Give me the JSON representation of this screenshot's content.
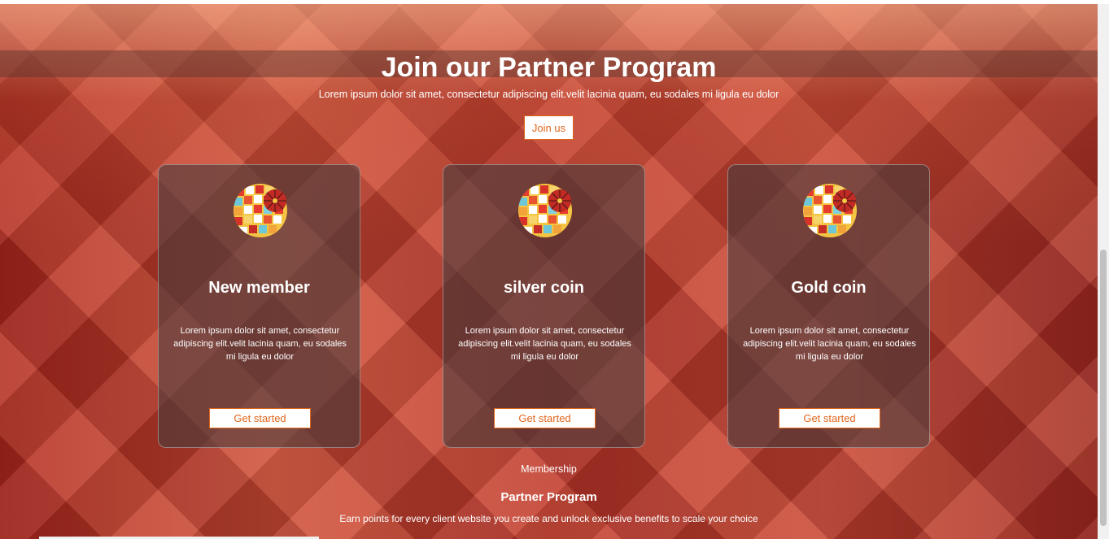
{
  "hero": {
    "title": "Join our Partner Program",
    "subtitle": "Lorem ipsum dolor sit amet, consectetur adipiscing elit.velit lacinia quam, eu sodales mi ligula eu dolor",
    "join_label": "Join us"
  },
  "cards": [
    {
      "title": "New member",
      "description": "Lorem ipsum dolor sit amet, consectetur adipiscing elit.velit lacinia quam, eu sodales mi ligula eu dolor",
      "button_label": "Get started"
    },
    {
      "title": "silver coin",
      "description": "Lorem ipsum dolor sit amet, consectetur adipiscing elit.velit lacinia quam, eu sodales mi ligula eu dolor",
      "button_label": "Get started"
    },
    {
      "title": "Gold coin",
      "description": "Lorem ipsum dolor sit amet, consectetur adipiscing elit.velit lacinia quam, eu sodales mi ligula eu dolor",
      "button_label": "Get started"
    }
  ],
  "footer": {
    "membership_link": "Membership",
    "partner_title": "Partner Program",
    "partner_text": "Earn points for every client website you create and unlock exclusive benefits to scale your choice"
  },
  "colors": {
    "accent": "#e0661b",
    "card_bg": "#4b3c3c",
    "text": "#ffffff"
  },
  "icons": {
    "card_logo": "mosaic-globe-icon"
  }
}
